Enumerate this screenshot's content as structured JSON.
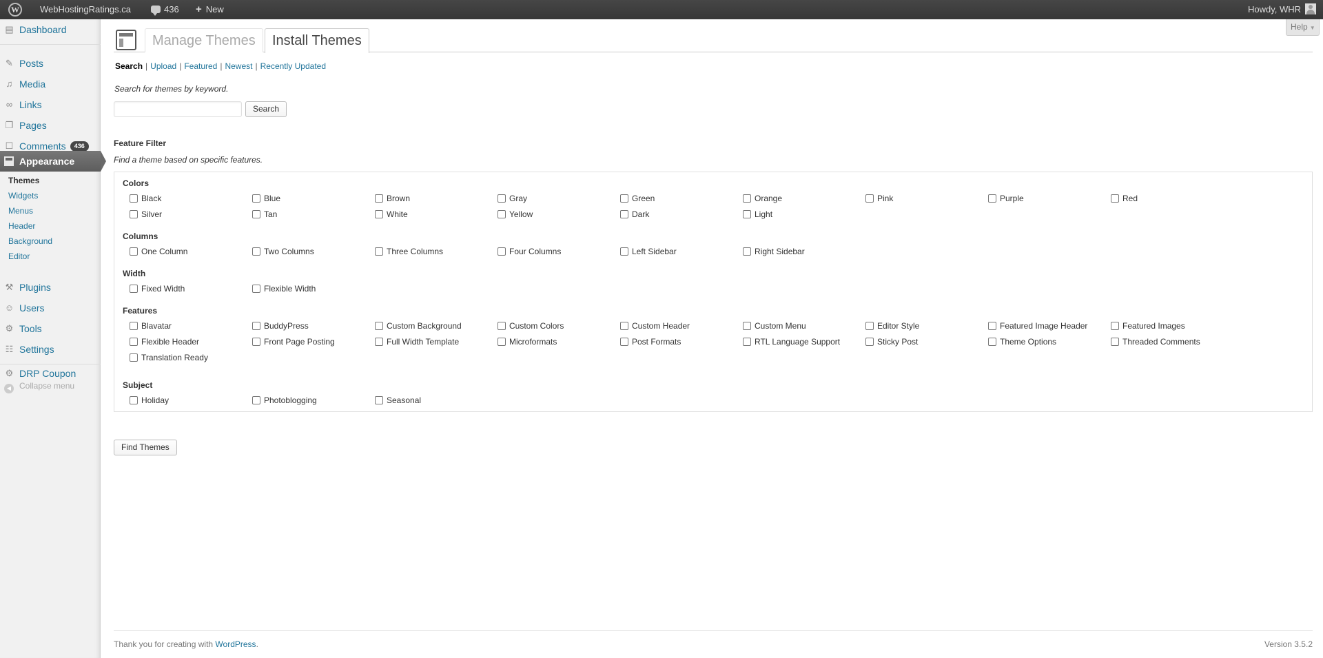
{
  "adminbar": {
    "site_name": "WebHostingRatings.ca",
    "comments_count": "436",
    "new_label": "New",
    "howdy": "Howdy, WHR"
  },
  "sidebar": {
    "dashboard": "Dashboard",
    "posts": "Posts",
    "media": "Media",
    "links": "Links",
    "pages": "Pages",
    "comments": "Comments",
    "comments_badge": "436",
    "appearance": "Appearance",
    "sub": [
      "Themes",
      "Widgets",
      "Menus",
      "Header",
      "Background",
      "Editor"
    ],
    "plugins": "Plugins",
    "users": "Users",
    "tools": "Tools",
    "settings": "Settings",
    "drp_coupon": "DRP Coupon",
    "collapse": "Collapse menu"
  },
  "help_label": "Help",
  "tabs": {
    "manage": "Manage Themes",
    "install": "Install Themes"
  },
  "subnav": {
    "search": "Search",
    "upload": "Upload",
    "featured": "Featured",
    "newest": "Newest",
    "recently_updated": "Recently Updated",
    "sep": "|"
  },
  "search": {
    "description": "Search for themes by keyword.",
    "value": "",
    "button": "Search"
  },
  "feature_filter": {
    "title": "Feature Filter",
    "description": "Find a theme based on specific features.",
    "colors_label": "Colors",
    "colors": [
      "Black",
      "Blue",
      "Brown",
      "Gray",
      "Green",
      "Orange",
      "Pink",
      "Purple",
      "Red",
      "Silver",
      "Tan",
      "White",
      "Yellow",
      "Dark",
      "Light"
    ],
    "columns_label": "Columns",
    "columns": [
      "One Column",
      "Two Columns",
      "Three Columns",
      "Four Columns",
      "Left Sidebar",
      "Right Sidebar"
    ],
    "width_label": "Width",
    "width": [
      "Fixed Width",
      "Flexible Width"
    ],
    "features_label": "Features",
    "features": [
      "Blavatar",
      "BuddyPress",
      "Custom Background",
      "Custom Colors",
      "Custom Header",
      "Custom Menu",
      "Editor Style",
      "Featured Image Header",
      "Featured Images",
      "Flexible Header",
      "Front Page Posting",
      "Full Width Template",
      "Microformats",
      "Post Formats",
      "RTL Language Support",
      "Sticky Post",
      "Theme Options",
      "Threaded Comments",
      "Translation Ready"
    ],
    "subject_label": "Subject",
    "subject": [
      "Holiday",
      "Photoblogging",
      "Seasonal"
    ],
    "find_button": "Find Themes"
  },
  "footer": {
    "thanks": "Thank you for creating with",
    "wp_link": "WordPress",
    "period": ".",
    "version": "Version 3.5.2"
  }
}
